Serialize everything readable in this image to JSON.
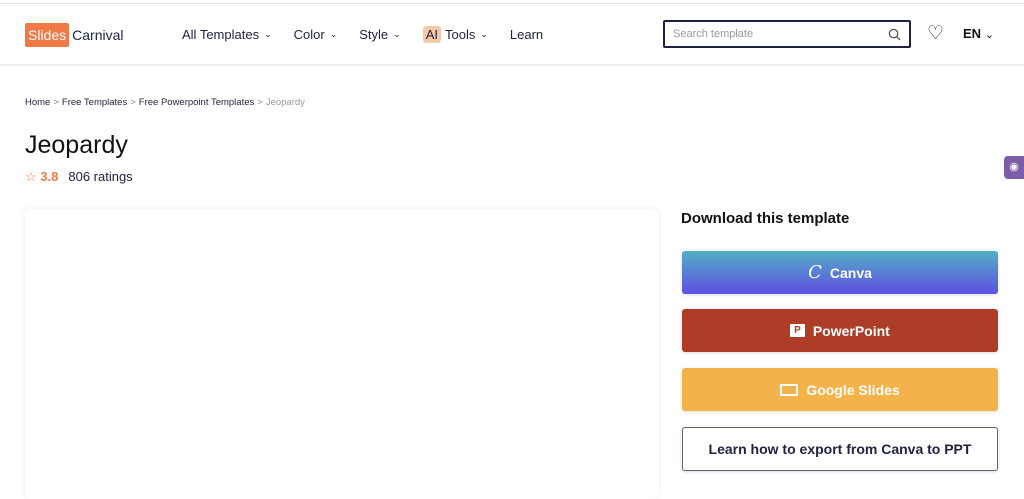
{
  "logo": {
    "part1": "Slides",
    "part2": "Carnival"
  },
  "nav": [
    {
      "label": "All Templates"
    },
    {
      "label": "Color"
    },
    {
      "label": "Style"
    },
    {
      "badge": "AI",
      "label": "Tools"
    },
    {
      "label": "Learn"
    }
  ],
  "search": {
    "placeholder": "Search template"
  },
  "lang": "EN",
  "breadcrumb": [
    "Home",
    "Free Templates",
    "Free Powerpoint Templates",
    "Jeopardy"
  ],
  "title": "Jeopardy",
  "rating": {
    "value": "3.8",
    "count": "806 ratings"
  },
  "download": {
    "heading": "Download this template",
    "canva": "Canva",
    "powerpoint": "PowerPoint",
    "google": "Google Slides",
    "learn": "Learn how to export from Canva to PPT"
  }
}
